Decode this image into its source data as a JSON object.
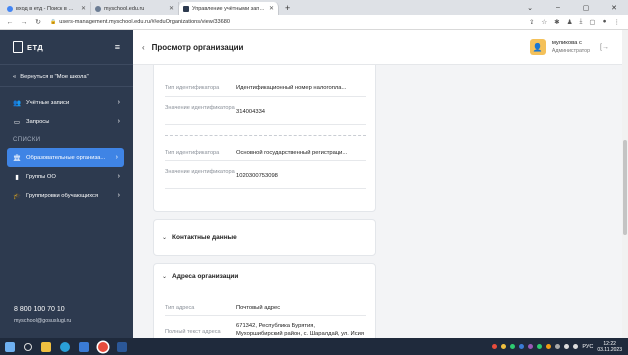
{
  "browser": {
    "tabs": [
      {
        "title": "вход в етд - Поиск в Google",
        "favicon_color": "#4285f4"
      },
      {
        "title": "myschool.edu.ru",
        "favicon_color": "#6b7c93"
      },
      {
        "title": "Управление учётными записями",
        "favicon_color": "#2d3a4f"
      }
    ],
    "new_tab": "+",
    "url": "users-management.myschool.edu.ru/#/eduOrganizations/view/33680",
    "window_controls": [
      "⌄",
      "–",
      "▢",
      "✕"
    ]
  },
  "app": {
    "logo_text": "ЕТД",
    "sidebar": {
      "back_label": "Вернуться в \"Мое школа\"",
      "items_top": [
        {
          "label": "Учётные записи",
          "icon": "users-icon",
          "glyph": "👥"
        },
        {
          "label": "Запросы",
          "icon": "requests-icon",
          "glyph": "▭"
        }
      ],
      "section": "СПИСКИ",
      "items_lists": [
        {
          "label": "Образовательные организа...",
          "icon": "institution-icon",
          "glyph": "🏛"
        },
        {
          "label": "Группы ОО",
          "icon": "bookmark-icon",
          "glyph": "▮"
        },
        {
          "label": "Группировки обучающихся",
          "icon": "graduation-cap-icon",
          "glyph": "🎓"
        }
      ],
      "phone": "8 800 100 70 10",
      "email": "myschool@gosuslugi.ru"
    },
    "topbar": {
      "title": "Просмотр организации",
      "user_name": "муликова с",
      "user_role": "Администратор"
    },
    "identifiers": [
      {
        "type_label": "Тип идентификатора",
        "type_value": "Идентификационный номер налогопла...",
        "value_label": "Значение идентификатора",
        "value": "314004334"
      },
      {
        "type_label": "Тип идентификатора",
        "type_value": "Основной государственный регистраци...",
        "value_label": "Значение идентификатора",
        "value": "1020300753098"
      }
    ],
    "contacts_title": "Контактные данные",
    "address": {
      "title": "Адреса организации",
      "type_label": "Тип адреса",
      "type_value": "Почтовый адрес",
      "full_label": "Полный текст адреса",
      "full_value_1": "671342, Республика Бурятия,",
      "full_value_2": "Мухоршибирский район, с. Шаралдай, ул. Исия"
    }
  },
  "taskbar": {
    "lang": "РУС",
    "time": "12:22",
    "date": "03.11.2023"
  }
}
